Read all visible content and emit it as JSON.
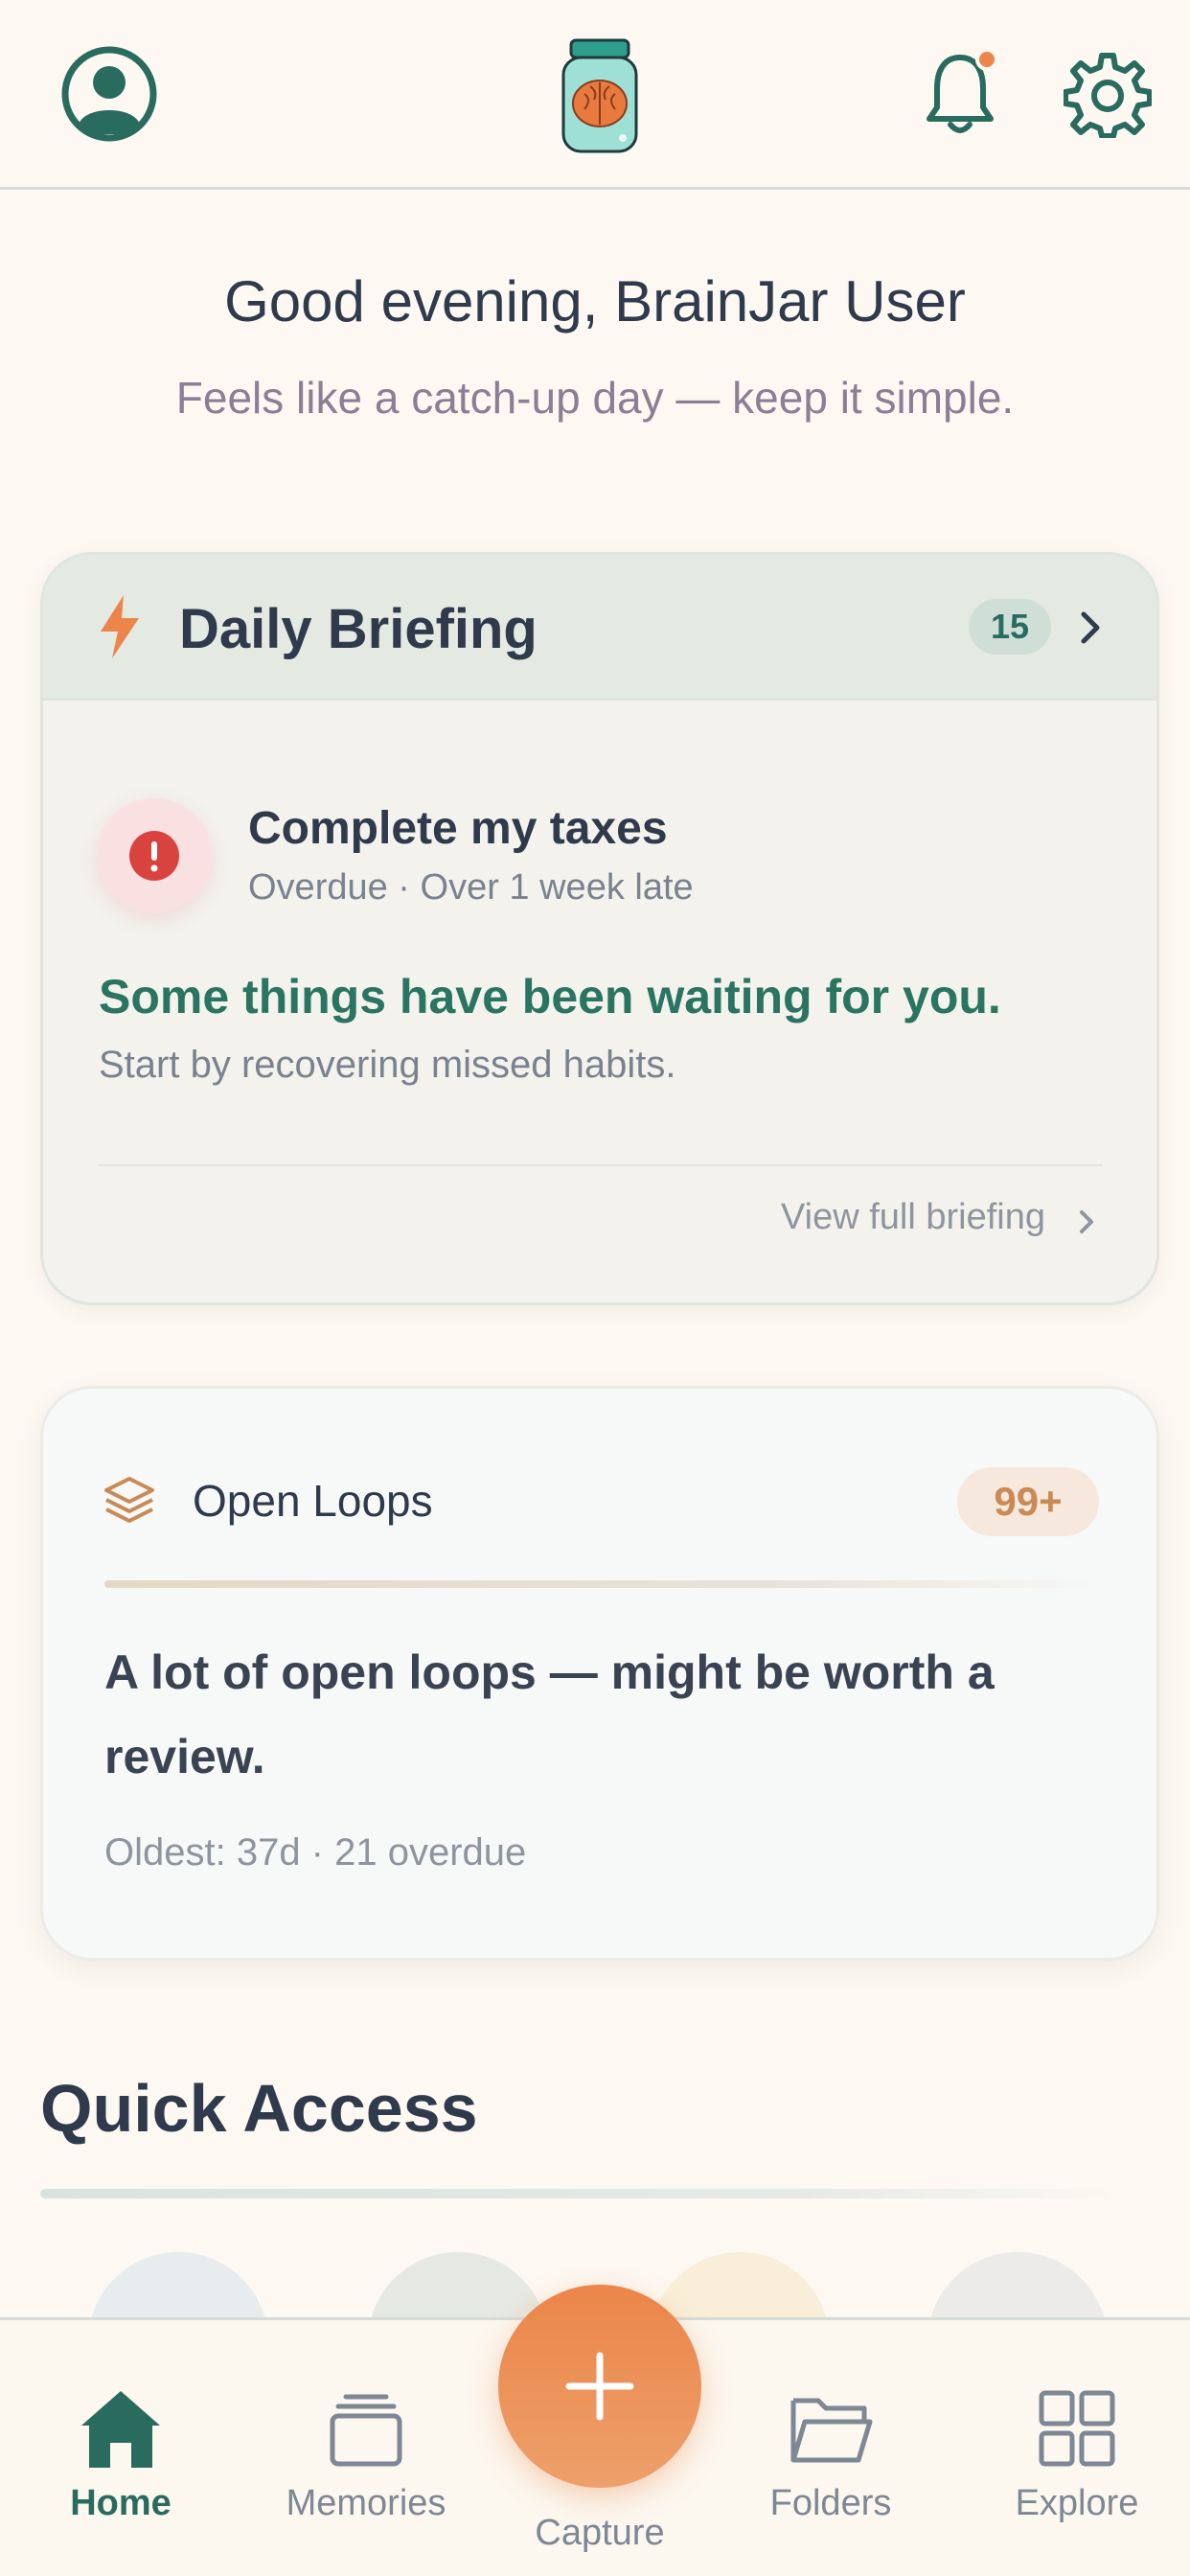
{
  "header": {
    "profile_icon": "user-circle-icon",
    "logo_icon": "brain-jar-icon",
    "notification_icon": "bell-icon",
    "settings_icon": "gear-icon"
  },
  "greeting": {
    "title": "Good evening, BrainJar User",
    "subtitle": "Feels like a catch-up day — keep it simple."
  },
  "briefing": {
    "title": "Daily Briefing",
    "count": "15",
    "task_title": "Complete my taxes",
    "task_status": "Overdue · Over 1 week late",
    "message": "Some things have been waiting for you.",
    "hint": "Start by recovering missed habits.",
    "link": "View full briefing"
  },
  "open_loops": {
    "title": "Open Loops",
    "badge": "99+",
    "message": "A lot of open loops — might be worth a review.",
    "meta": "Oldest: 37d · 21 overdue"
  },
  "quick_access": {
    "title": "Quick Access"
  },
  "nav": {
    "home": "Home",
    "memories": "Memories",
    "capture": "Capture",
    "folders": "Folders",
    "explore": "Explore"
  },
  "colors": {
    "accent": "#2a6b5f",
    "capture": "#ec8549",
    "alert": "#d9433f"
  }
}
